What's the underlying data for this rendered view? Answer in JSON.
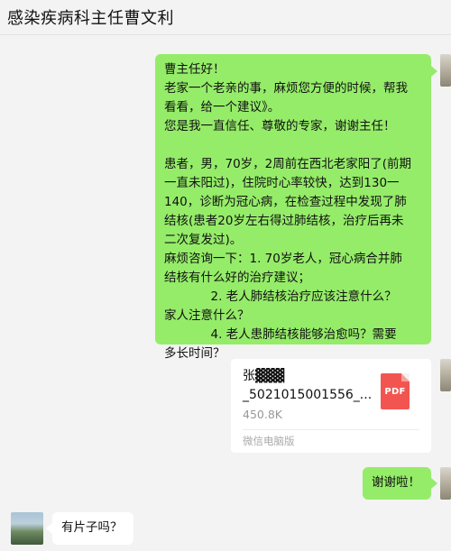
{
  "window": {
    "title": "感染疾病科主任曹文利"
  },
  "messages": [
    {
      "sender": "self",
      "type": "text",
      "lines": [
        "曹主任好！",
        "老家一个老亲的事，麻烦您方便的时候，帮我",
        "看看，给一个建议》。",
        "您是我一直信任、尊敬的专家，谢谢主任！",
        "",
        "患者，男，70岁，2周前在西北老家阳了(前期",
        "一直未阳过)，住院时心率较快，达到130一",
        "140，诊断为冠心病，在检查过程中发现了肺",
        "结核(患者20岁左右得过肺结核，治疗后再未",
        "二次复发过)。",
        "麻烦咨询一下：1. 70岁老人，冠心病合并肺",
        "结核有什么好的治疗建议；",
        "            2. 老人肺结核治疗应该注意什么？",
        "家人注意什么？",
        "            4. 老人患肺结核能够治愈吗？需要",
        "多长时间？"
      ]
    },
    {
      "sender": "self",
      "type": "file",
      "file": {
        "name_line1": "张▓▓▓",
        "name_line2": "_5021015001556_...",
        "size": "450.8K",
        "icon_label": "PDF",
        "source": "微信电脑版"
      }
    },
    {
      "sender": "self",
      "type": "text",
      "lines": [
        "谢谢啦！"
      ]
    },
    {
      "sender": "other",
      "type": "text",
      "lines": [
        "有片子吗？"
      ]
    }
  ],
  "colors": {
    "self_bubble": "#95ec69",
    "other_bubble": "#ffffff",
    "background": "#f3f3f3",
    "pdf_icon": "#f25550"
  }
}
